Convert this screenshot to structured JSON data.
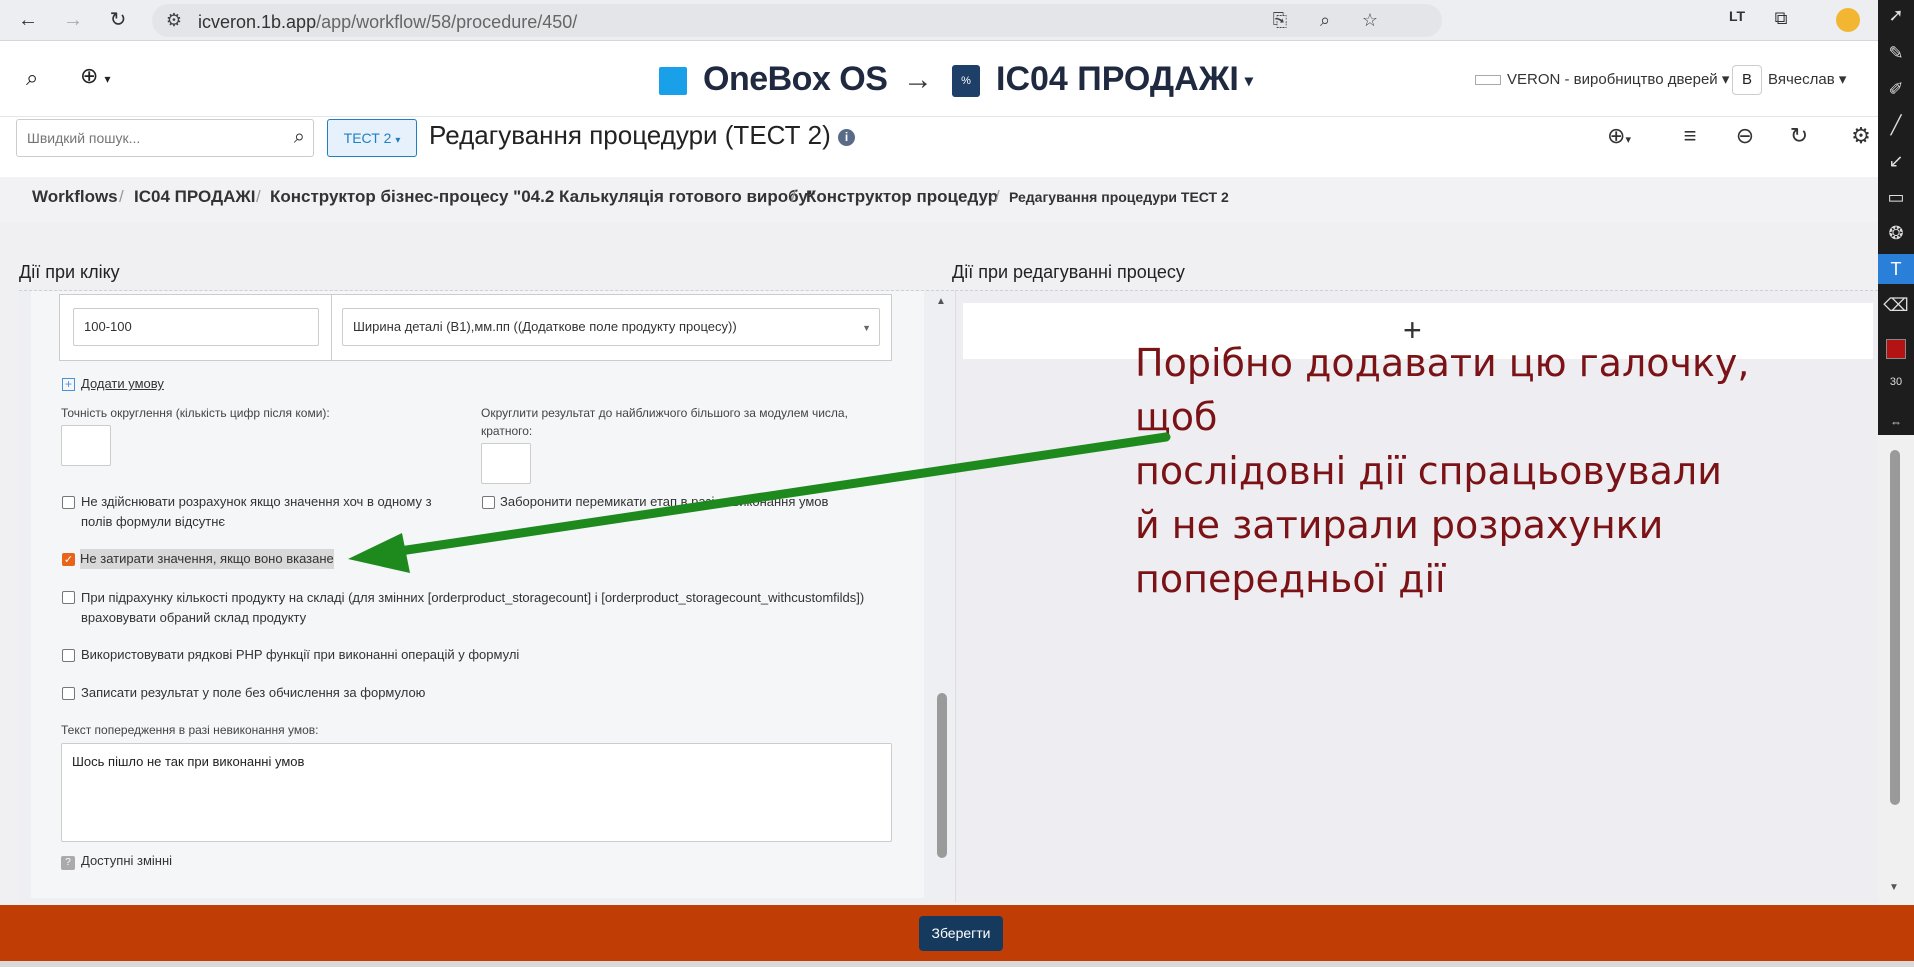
{
  "browser": {
    "url_host": "icveron.1b.app",
    "url_path": "/app/workflow/58/procedure/450/"
  },
  "header": {
    "brand": "OneBox OS",
    "arrow": "→",
    "project": "ІС04 ПРОДАЖІ",
    "company": "VERON - виробництво дверей",
    "avatar_letter": "В",
    "username": "Вячеслав"
  },
  "toolbar": {
    "search_placeholder": "Швидкий пошук...",
    "test_button": "ТЕСТ 2",
    "page_title": "Редагування процедури (ТЕСТ 2)",
    "info": "i"
  },
  "breadcrumbs": [
    "Workflows",
    "ІС04 ПРОДАЖІ",
    "Конструктор бізнес-процесу \"04.2 Калькуляція готового виробу\"",
    "Конструктор процедур",
    "Редагування процедури ТЕСТ 2"
  ],
  "panels": {
    "left_title": "Дії при кліку",
    "right_title": "Дії при редагуванні процесу"
  },
  "form": {
    "condition_value": "100-100",
    "condition_field": "Ширина деталі (В1),мм.пп ((Додаткове поле продукту процесу))",
    "add_condition": "Додати умову",
    "rounding_label": "Точність округлення (кількість цифр після коми):",
    "round_nearest_label": "Округлити результат до найближчого більшого за модулем числа, кратного:",
    "cb_no_calc": "Не здійснювати розрахунок якщо значення хоч в одному з полів формули відсутнє",
    "cb_forbid_stage": "Заборонити перемикати етап в разі невиконання умов",
    "cb_no_overwrite": "Не затирати значення, якщо воно вказане",
    "cb_storage": "При підрахунку кількості продукту на складі (для змінних [orderproduct_storagecount] і [orderproduct_storagecount_withcustomfilds]) враховувати обраний склад продукту",
    "cb_php": "Використовувати рядкові PHP функції при виконанні операцій у формулі",
    "cb_no_formula": "Записати результат у поле без обчислення за формулою",
    "warning_label": "Текст попередження в разі невиконання умов:",
    "warning_text": "Шось пішло не так при виконанні умов",
    "available_vars": "Доступні змінні"
  },
  "annotation": {
    "text_line1": "Порібно додавати цю галочку, щоб",
    "text_line2": "послідовні дії спрацьовували",
    "text_line3": "й не затирали розрахунки",
    "text_line4": "попередньої дії",
    "color": "#7a1216",
    "arrow_color": "#1e8a1e"
  },
  "palette": {
    "size": "30"
  },
  "footer": {
    "save": "Зберегти",
    "bar_color": "#c03d06"
  }
}
